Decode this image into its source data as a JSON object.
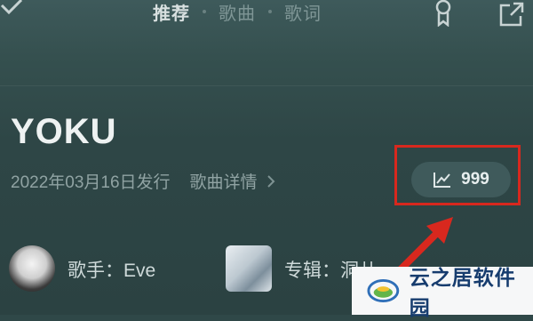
{
  "topbar": {
    "tabs": [
      {
        "label": "推荐",
        "active": true
      },
      {
        "label": "歌曲",
        "active": false
      },
      {
        "label": "歌词",
        "active": false
      }
    ],
    "icons": [
      "back-icon",
      "award-icon",
      "share-icon"
    ]
  },
  "song": {
    "title": "YOKU",
    "release": "2022年03月16日发行",
    "details_link": "歌曲详情"
  },
  "stats": {
    "value": "999",
    "icon": "trend-chart-icon"
  },
  "artist": {
    "label": "歌手：Eve"
  },
  "album": {
    "label": "专辑：洞儿"
  },
  "watermark": {
    "text": "云之居软件园"
  },
  "colors": {
    "background": "#2f4848",
    "highlight": "#d8281e",
    "text_primary": "#eef2f2",
    "text_secondary": "#90a3a3"
  }
}
